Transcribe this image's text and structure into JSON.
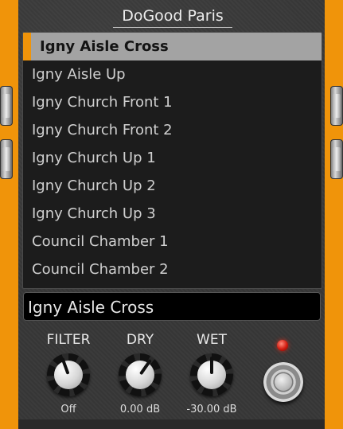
{
  "header": {
    "title": "DoGood Paris"
  },
  "preset_list": {
    "items": [
      {
        "label": "Igny Aisle Cross",
        "selected": true
      },
      {
        "label": "Igny Aisle Up"
      },
      {
        "label": "Igny Church Front 1"
      },
      {
        "label": "Igny Church Front 2"
      },
      {
        "label": "Igny Church Up 1"
      },
      {
        "label": "Igny Church Up 2"
      },
      {
        "label": "Igny Church Up 3"
      },
      {
        "label": "Council Chamber 1"
      },
      {
        "label": "Council Chamber 2"
      }
    ]
  },
  "preset_name": {
    "value": "Igny Aisle Cross"
  },
  "controls": {
    "filter": {
      "label": "FILTER",
      "value": "Off",
      "pointer_deg": -20
    },
    "dry": {
      "label": "DRY",
      "value": "0.00 dB",
      "pointer_deg": 35
    },
    "wet": {
      "label": "WET",
      "value": "-30.00 dB",
      "pointer_deg": 0
    }
  },
  "indicators": {
    "led_color": "#d21c10",
    "led_on": true
  },
  "colors": {
    "accent": "#f0940a",
    "selected_bg": "#a3a3a3"
  }
}
